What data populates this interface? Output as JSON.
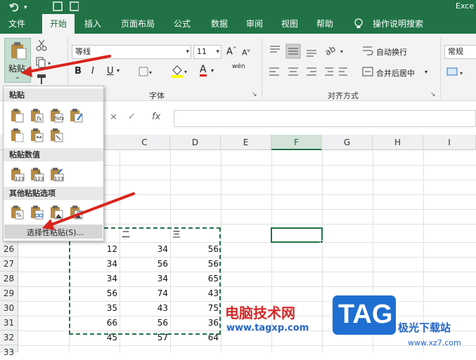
{
  "window": {
    "app_name": "Exce"
  },
  "tabs": [
    "文件",
    "开始",
    "插入",
    "页面布局",
    "公式",
    "数据",
    "审阅",
    "视图",
    "帮助",
    "操作说明搜索"
  ],
  "ribbon": {
    "paste_label": "粘贴",
    "font_name": "等线",
    "font_size": "11",
    "font_group_label": "字体",
    "align_group_label": "对齐方式",
    "wrap_text": "自动换行",
    "merge_center": "合并后居中",
    "number_format": "常规",
    "bold": "B",
    "italic": "I",
    "underline": "U",
    "font_color": "A",
    "wen": "wén"
  },
  "formula_bar": {
    "fx": "fx"
  },
  "columns": [
    "C",
    "D",
    "E",
    "F",
    "G",
    "H",
    "I"
  ],
  "rows": [
    "26",
    "27",
    "28",
    "29",
    "30",
    "31",
    "32",
    "33"
  ],
  "header_cells": {
    "c": "二",
    "d": "三"
  },
  "data": [
    [
      "12",
      "34",
      "56"
    ],
    [
      "34",
      "56",
      "56"
    ],
    [
      "34",
      "34",
      "65"
    ],
    [
      "56",
      "74",
      "43"
    ],
    [
      "35",
      "43",
      "75"
    ],
    [
      "66",
      "56",
      "36"
    ],
    [
      "45",
      "57",
      "64"
    ]
  ],
  "paste_menu": {
    "section_paste": "粘贴",
    "section_values": "粘贴数值",
    "section_other": "其他粘贴选项",
    "paste_special": "选择性粘贴(S)..."
  },
  "watermark": {
    "line1": "电脑技术网",
    "line2": "www.tagxp.com",
    "tag": "TAG",
    "brand": "极光下载站",
    "url": "www.xz7.com"
  },
  "colors": {
    "excel_green": "#217346",
    "arrow_red": "#d9251d",
    "tag_blue": "#1f6fd1"
  }
}
